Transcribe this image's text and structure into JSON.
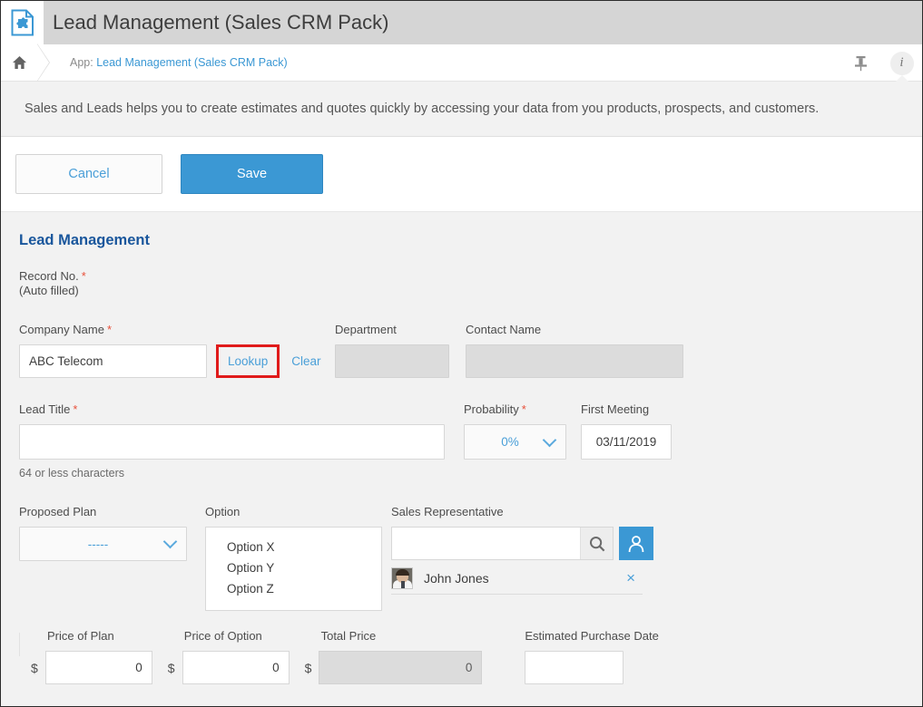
{
  "window": {
    "title": "Lead Management (Sales CRM Pack)",
    "app_icon": "app-puzzle-document-icon"
  },
  "breadcrumb": {
    "home_icon": "home-icon",
    "prefix": "App:",
    "link": "Lead Management (Sales CRM Pack)",
    "pin_icon": "pin-icon",
    "info_icon": "i"
  },
  "banner": {
    "text": "Sales and Leads helps you to create estimates and quotes quickly by accessing your data from you products, prospects, and customers."
  },
  "actions": {
    "cancel_label": "Cancel",
    "save_label": "Save"
  },
  "form": {
    "section_title": "Lead Management",
    "record_no": {
      "label": "Record No.",
      "required": "*",
      "value": "(Auto filled)"
    },
    "company_name": {
      "label": "Company Name",
      "required": "*",
      "value": "ABC Telecom",
      "lookup_label": "Lookup",
      "clear_label": "Clear"
    },
    "department": {
      "label": "Department",
      "value": ""
    },
    "contact_name": {
      "label": "Contact Name",
      "value": ""
    },
    "lead_title": {
      "label": "Lead Title",
      "required": "*",
      "value": "",
      "hint": "64 or less characters"
    },
    "probability": {
      "label": "Probability",
      "required": "*",
      "value": "0%"
    },
    "first_meeting": {
      "label": "First Meeting",
      "value": "03/11/2019"
    },
    "proposed_plan": {
      "label": "Proposed Plan",
      "value": "-----"
    },
    "option": {
      "label": "Option",
      "items": [
        "Option X",
        "Option Y",
        "Option Z"
      ]
    },
    "sales_rep": {
      "label": "Sales Representative",
      "search_value": "",
      "search_icon": "magnifier-icon",
      "person_button_icon": "person-icon",
      "selected_name": "John Jones",
      "remove_icon": "×"
    },
    "price_of_plan": {
      "label": "Price of Plan",
      "currency": "$",
      "value": "0"
    },
    "price_of_option": {
      "label": "Price of Option",
      "currency": "$",
      "value": "0"
    },
    "total_price": {
      "label": "Total Price",
      "currency": "$",
      "value": "0"
    },
    "estimated_purchase_date": {
      "label": "Estimated Purchase Date",
      "value": ""
    }
  },
  "colors": {
    "accent": "#3b98d4",
    "link": "#4a9fd8",
    "section_title": "#19569c",
    "required": "#e8503a",
    "annotation": "#e01b1b",
    "titlebar": "#d5d5d5",
    "form_bg": "#f2f2f2",
    "disabled_field": "#dcdcdc"
  }
}
